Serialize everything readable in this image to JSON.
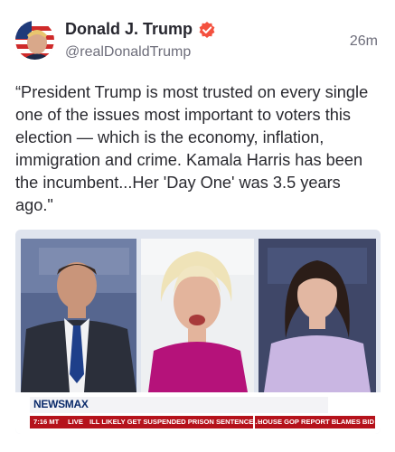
{
  "post": {
    "author_name": "Donald J. Trump",
    "handle": "@realDonaldTrump",
    "time_ago": "26m",
    "verified_icon": "verified-badge-icon",
    "text": "“President Trump is most trusted on every single one of the issues most important to voters this election — which is the economy, inflation, immigration and crime. Kamala Harris has been the incumbent...Her 'Day One' was 3.5 years ago.\""
  },
  "media": {
    "brand": "NEWSMAX",
    "ticker": {
      "time": "7:16 MT",
      "live": "LIVE",
      "headline_1": "ILL LIKELY GET SUSPENDED PRISON SENTENCE . . .",
      "headline_2": "HOUSE GOP REPORT BLAMES BID"
    }
  },
  "colors": {
    "verified_badge": "#f4513f",
    "ticker_red": "#b5121b",
    "brand_navy": "#0b2b6b"
  }
}
